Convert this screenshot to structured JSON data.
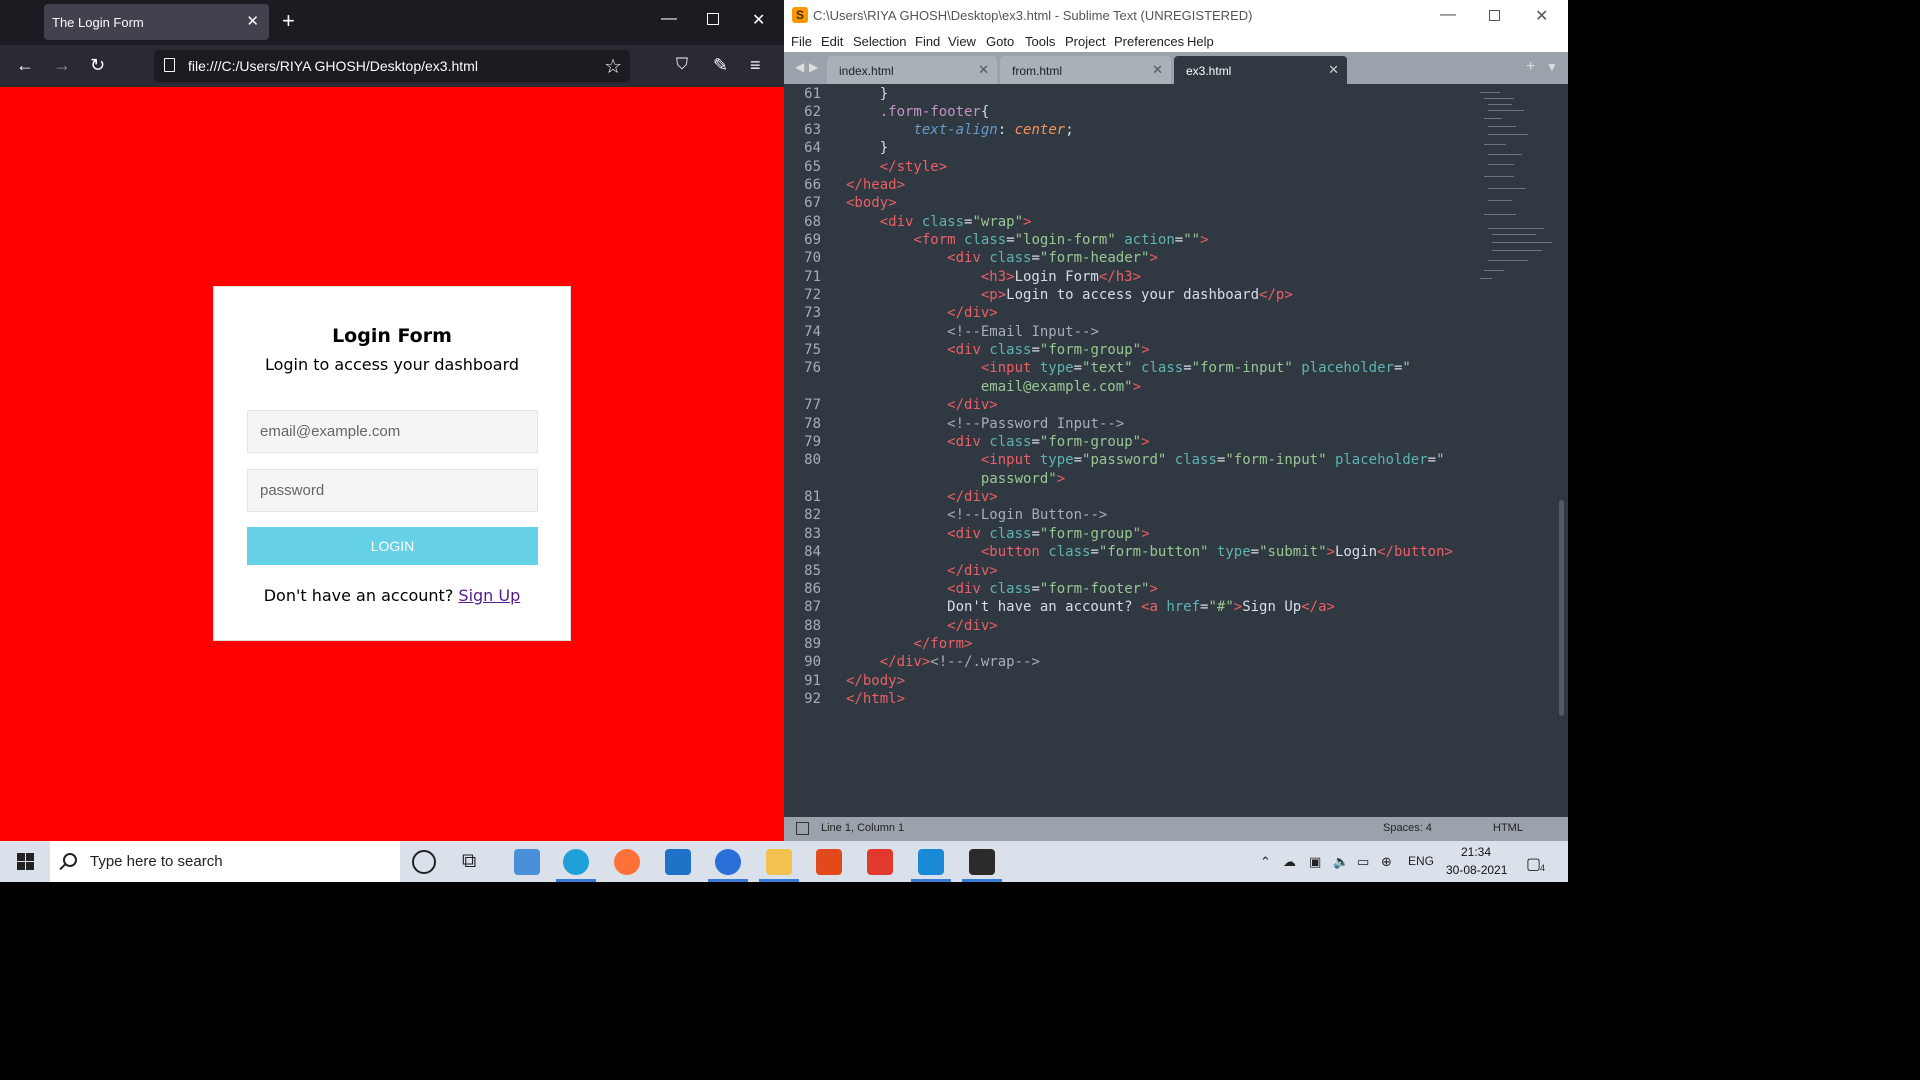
{
  "firefox": {
    "tab_title": "The Login Form",
    "url": "file:///C:/Users/RIYA GHOSH/Desktop/ex3.html",
    "new_tab": "+",
    "close": "✕"
  },
  "login_form": {
    "title": "Login Form",
    "subtitle": "Login to access your dashboard",
    "email_placeholder": "email@example.com",
    "password_placeholder": "password",
    "button_label": "LOGIN",
    "footer_text": "Don't have an account?",
    "signup_label": "Sign Up"
  },
  "sublime": {
    "title": "C:\\Users\\RIYA GHOSH\\Desktop\\ex3.html - Sublime Text (UNREGISTERED)",
    "menu": [
      "File",
      "Edit",
      "Selection",
      "Find",
      "View",
      "Goto",
      "Tools",
      "Project",
      "Preferences",
      "Help"
    ],
    "tabs": [
      {
        "label": "index.html",
        "active": false
      },
      {
        "label": "from.html",
        "active": false
      },
      {
        "label": "ex3.html",
        "active": true
      }
    ],
    "status": {
      "position": "Line 1, Column 1",
      "indent": "Spaces: 4",
      "syntax": "HTML"
    },
    "line_numbers": [
      "61",
      "62",
      "63",
      "64",
      "65",
      "66",
      "67",
      "68",
      "69",
      "70",
      "71",
      "72",
      "73",
      "74",
      "75",
      "76",
      "",
      "77",
      "78",
      "79",
      "80",
      "",
      "81",
      "82",
      "83",
      "84",
      "85",
      "86",
      "87",
      "88",
      "89",
      "90",
      "91",
      "92"
    ]
  },
  "taskbar": {
    "search_placeholder": "Type here to search",
    "language": "ENG",
    "time": "21:34",
    "date": "30-08-2021",
    "notification_count": "4"
  },
  "colors": {
    "page_bg": "#ff0000",
    "login_button": "#66d0e6",
    "editor_bg": "#303841"
  }
}
